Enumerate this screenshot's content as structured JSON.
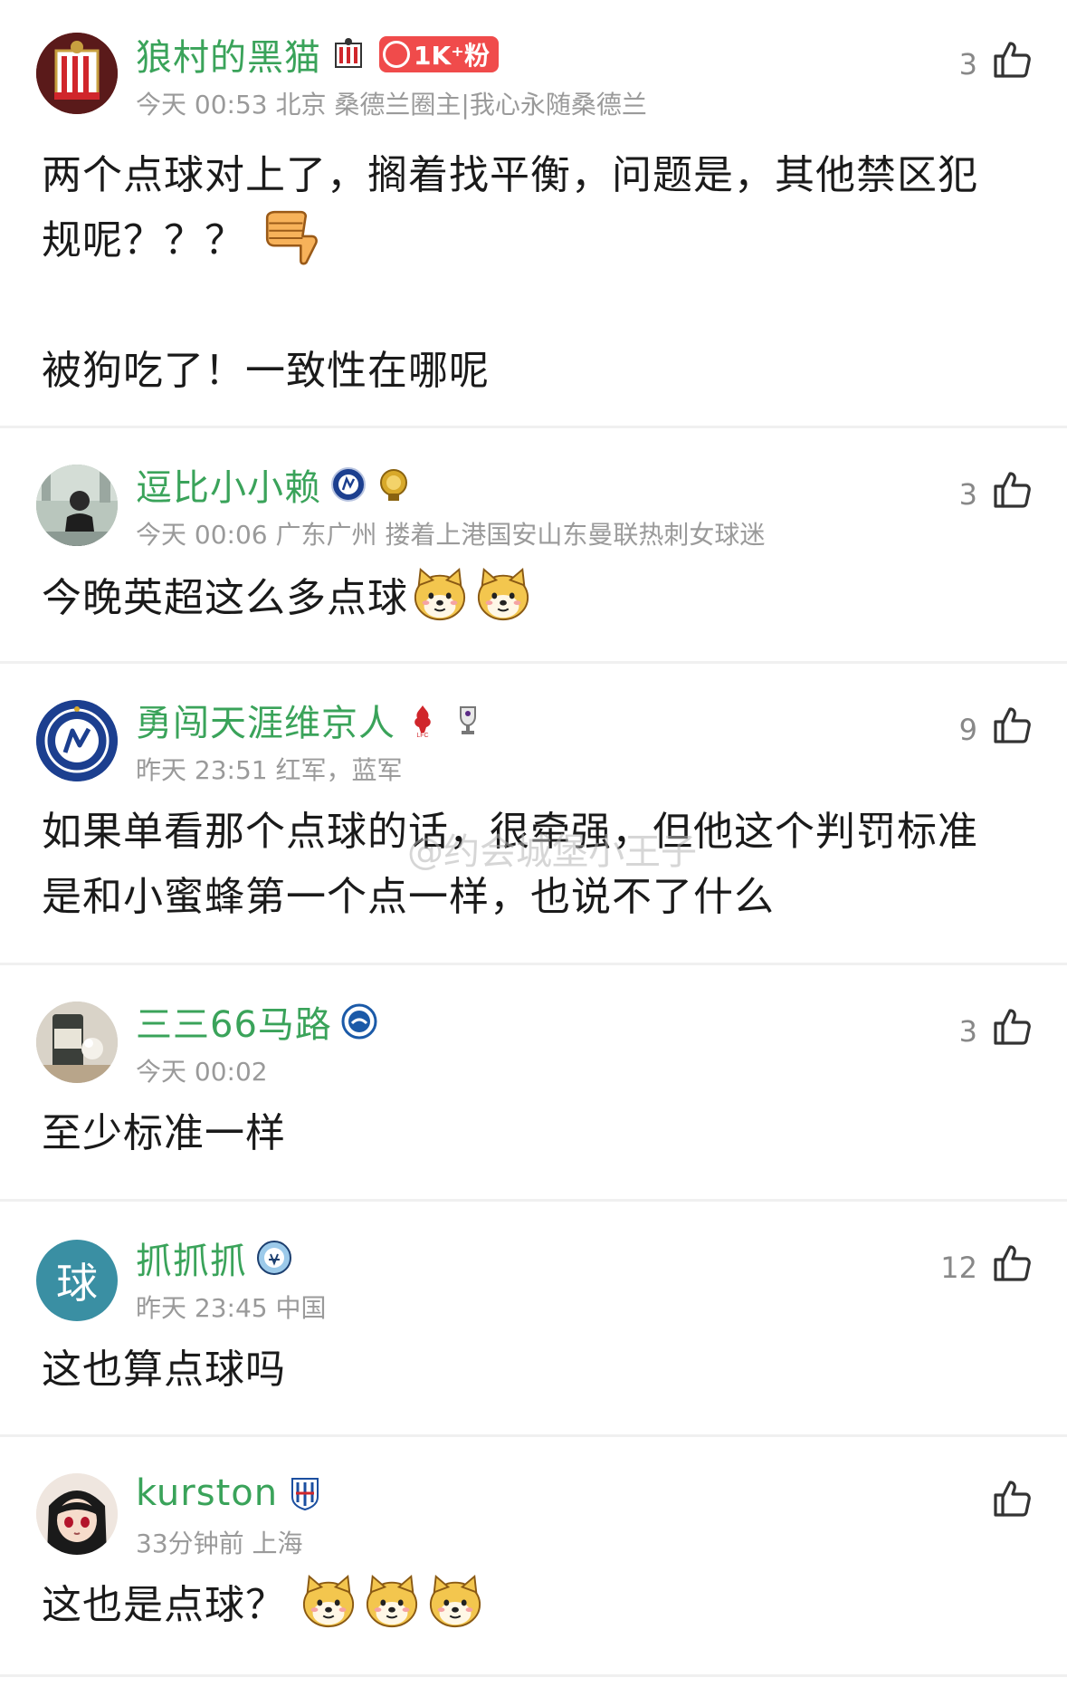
{
  "comments": [
    {
      "name": "狼村的黑猫",
      "fan_badge": "1K⁺粉",
      "meta": "今天 00:53 北京 桑德兰圈主|我心永随桑德兰",
      "likes": "3",
      "content_line1": "两个点球对上了，搁着找平衡，问题是，其他禁区犯",
      "content_line2": "规呢？？？",
      "content_line3": "被狗吃了！一致性在哪呢"
    },
    {
      "name": "逗比小小赖",
      "meta": "今天 00:06 广东广州 搂着上港国安山东曼联热刺女球迷",
      "likes": "3",
      "content": "今晚英超这么多点球"
    },
    {
      "name": "勇闯天涯维京人",
      "meta": "昨天 23:51 红军，蓝军",
      "likes": "9",
      "content_line1": "如果单看那个点球的话，很牵强，但他这个判罚标准",
      "content_line2": "是和小蜜蜂第一个点一样，也说不了什么"
    },
    {
      "name": "三三66马路",
      "meta": "今天 00:02",
      "likes": "3",
      "content": "至少标准一样"
    },
    {
      "name": "抓抓抓",
      "avatar_text": "球",
      "meta": "昨天 23:45 中国",
      "likes": "12",
      "content": "这也算点球吗"
    },
    {
      "name": "kurston",
      "meta": "33分钟前 上海",
      "likes": "",
      "content": "这也是点球？"
    }
  ],
  "watermark": "@约会城堡小王子",
  "icons": {
    "like": "thumbs-up-icon",
    "dislike_emoji": "thumbs-down-emoji",
    "dog_emoji": "doge-emoji"
  },
  "colors": {
    "name_green": "#3aa35a",
    "fan_red": "#f04b4b",
    "meta_gray": "#9a9a9a",
    "avatar_teal": "#3a8fa3"
  }
}
